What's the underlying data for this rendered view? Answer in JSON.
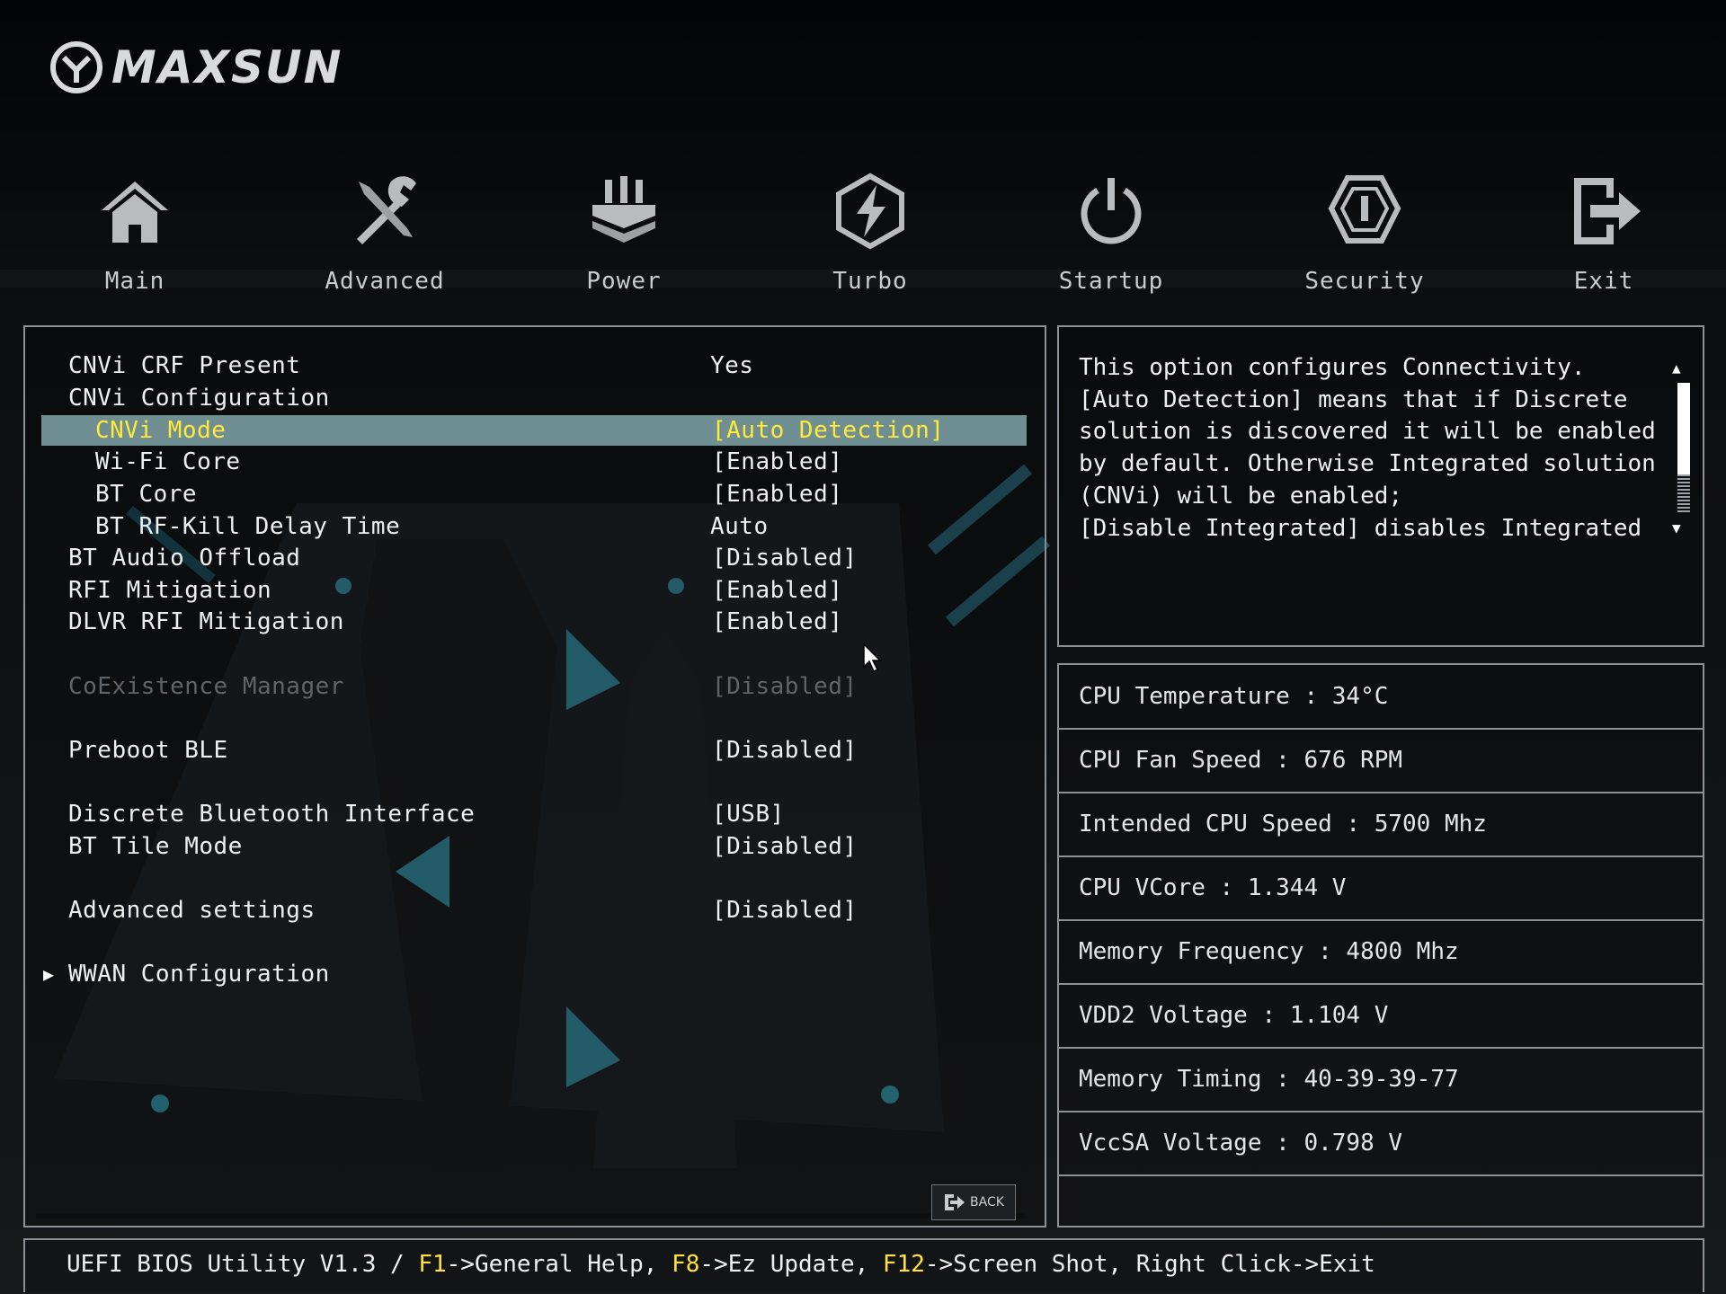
{
  "brand": {
    "name": "MAXSUN"
  },
  "nav": {
    "items": [
      {
        "label": "Main",
        "icon": "home-icon"
      },
      {
        "label": "Advanced",
        "icon": "tools-icon"
      },
      {
        "label": "Power",
        "icon": "power-plug-icon"
      },
      {
        "label": "Turbo",
        "icon": "turbo-bolt-icon"
      },
      {
        "label": "Startup",
        "icon": "power-button-icon"
      },
      {
        "label": "Security",
        "icon": "shield-icon"
      },
      {
        "label": "Exit",
        "icon": "exit-icon"
      }
    ]
  },
  "settings": {
    "rows": [
      {
        "label": "CNVi CRF Present",
        "value": "Yes"
      },
      {
        "label": "CNVi Configuration",
        "value": ""
      },
      {
        "label": "CNVi Mode",
        "value": "[Auto Detection]",
        "selected": true
      },
      {
        "label": "Wi-Fi Core",
        "value": "[Enabled]"
      },
      {
        "label": "BT Core",
        "value": "[Enabled]"
      },
      {
        "label": "BT RF-Kill Delay Time",
        "value": "Auto"
      },
      {
        "label": "BT Audio Offload",
        "value": "[Disabled]"
      },
      {
        "label": "RFI Mitigation",
        "value": "[Enabled]"
      },
      {
        "label": "DLVR RFI Mitigation",
        "value": "[Enabled]"
      },
      {
        "label": "CoExistence Manager",
        "value": "[Disabled]",
        "disabled": true
      },
      {
        "label": "Preboot BLE",
        "value": "[Disabled]"
      },
      {
        "label": "Discrete Bluetooth Interface",
        "value": "[USB]"
      },
      {
        "label": "BT Tile Mode",
        "value": "[Disabled]"
      },
      {
        "label": "Advanced settings",
        "value": "[Disabled]"
      },
      {
        "label": "WWAN Configuration",
        "value": "",
        "submenu": true
      }
    ],
    "back_label": "BACK"
  },
  "help": {
    "lines": [
      "This option configures Connectivity.",
      "[Auto Detection] means that if Discrete",
      "solution is discovered it will be enabled",
      "by default. Otherwise Integrated solution",
      "(CNVi) will be enabled;",
      "[Disable Integrated] disables Integrated"
    ]
  },
  "monitor": {
    "rows": [
      "CPU Temperature : 34°C",
      "CPU Fan Speed : 676 RPM",
      "Intended CPU Speed : 5700 Mhz",
      "CPU VCore : 1.344 V",
      "Memory Frequency : 4800 Mhz",
      "VDD2 Voltage : 1.104 V",
      "Memory Timing : 40-39-39-77",
      "VccSA Voltage : 0.798 V"
    ]
  },
  "status": {
    "prefix": "UEFI BIOS Utility V1.3 / ",
    "f1_key": "F1",
    "f1_text": "->General Help, ",
    "f8_key": "F8",
    "f8_text": "->Ez Update, ",
    "f12_key": "F12",
    "f12_text": "->Screen Shot, Right Click->Exit"
  },
  "colors": {
    "highlight_bar": "#6f8f93",
    "highlight_text": "#ffea3a",
    "key_text": "#ffe23a",
    "accent_teal": "#2b6f80"
  }
}
